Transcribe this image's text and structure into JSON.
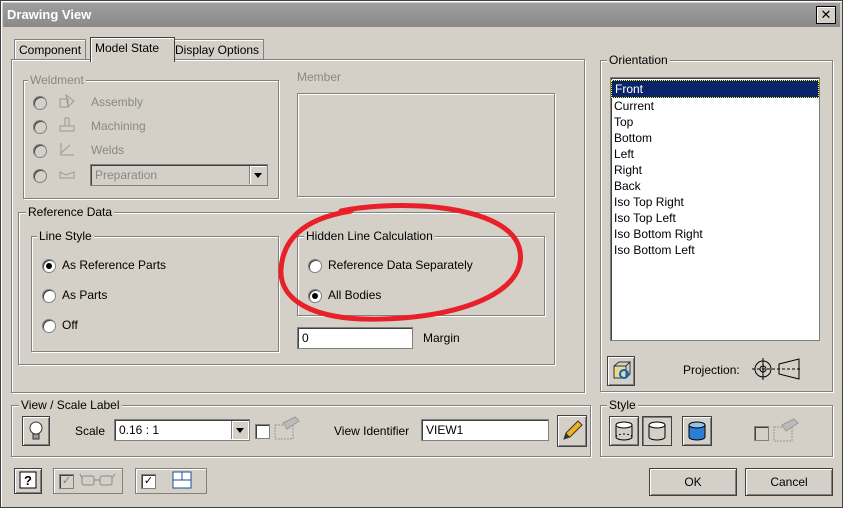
{
  "window": {
    "title": "Drawing View"
  },
  "tabs": [
    {
      "label": "Component"
    },
    {
      "label": "Model State"
    },
    {
      "label": "Display Options"
    }
  ],
  "weldment": {
    "label": "Weldment",
    "options": [
      "Assembly",
      "Machining",
      "Welds"
    ],
    "preparation": "Preparation"
  },
  "member": {
    "label": "Member"
  },
  "reference_data": {
    "label": "Reference Data",
    "line_style": {
      "label": "Line Style",
      "options": [
        "As Reference Parts",
        "As Parts",
        "Off"
      ],
      "selected": "As Reference Parts"
    },
    "hidden_line": {
      "label": "Hidden Line Calculation",
      "options": [
        "Reference Data Separately",
        "All Bodies"
      ],
      "selected": "All Bodies"
    },
    "margin_value": "0",
    "margin_label": "Margin"
  },
  "orientation": {
    "label": "Orientation",
    "items": [
      "Front",
      "Current",
      "Top",
      "Bottom",
      "Left",
      "Right",
      "Back",
      "Iso Top Right",
      "Iso Top Left",
      "Iso Bottom Right",
      "Iso Bottom Left"
    ],
    "selected": "Front",
    "projection_label": "Projection:"
  },
  "view_scale": {
    "label": "View / Scale Label",
    "scale_label": "Scale",
    "scale_value": "0.16 : 1",
    "view_identifier_label": "View Identifier",
    "view_identifier_value": "VIEW1"
  },
  "style": {
    "label": "Style"
  },
  "buttons": {
    "ok": "OK",
    "cancel": "Cancel"
  },
  "colors": {
    "annotation": "#e8202a",
    "selection": "#0a246a"
  }
}
